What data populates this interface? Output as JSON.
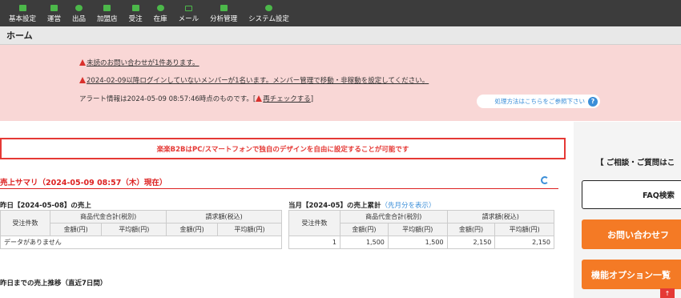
{
  "nav": {
    "items": [
      {
        "label": "基本設定",
        "icon": "sliders-icon"
      },
      {
        "label": "運営",
        "icon": "document-icon"
      },
      {
        "label": "出品",
        "icon": "tag-icon"
      },
      {
        "label": "加盟店",
        "icon": "store-icon"
      },
      {
        "label": "受注",
        "icon": "cart-icon"
      },
      {
        "label": "在庫",
        "icon": "box-icon"
      },
      {
        "label": "メール",
        "icon": "mail-icon"
      },
      {
        "label": "分析管理",
        "icon": "chart-icon"
      },
      {
        "label": "システム設定",
        "icon": "gear-icon"
      }
    ]
  },
  "breadcrumb": {
    "title": "ホーム"
  },
  "alerts": {
    "line1": "未読のお問い合わせが1件あります。",
    "line2": "2024-02-09以降ログインしていないメンバーが1名います。メンバー管理で移動・非稼動を設定してください。",
    "line3_prefix": "アラート情報は2024-05-09 08:57:46時点のものです。[",
    "line3_link": "再チェックする",
    "line3_suffix": "]",
    "help_text": "処理方法はこちらをご参照下さい",
    "help_icon": "?"
  },
  "banner": {
    "text": "楽楽B2BはPC/スマートフォンで独自のデザインを自由に設定することが可能です"
  },
  "summary": {
    "title": "売上サマリ（2024-05-09 08:57（木）現在）",
    "yesterday": {
      "title": "昨日【2024-05-08】の売上",
      "headers": {
        "orders": "受注件数",
        "product_total": "商品代金合計(税別)",
        "billing": "請求額(税込)",
        "amount": "金額(円)",
        "average": "平均額(円)"
      },
      "empty_text": "データがありません"
    },
    "month": {
      "title": "当月【2024-05】の売上累計",
      "prev_link": "（先月分を表示）",
      "headers": {
        "orders": "受注件数",
        "product_total": "商品代金合計(税別)",
        "billing": "請求額(税込)",
        "amount": "金額(円)",
        "average": "平均額(円)"
      },
      "row": {
        "orders": "1",
        "product_amount": "1,500",
        "product_average": "1,500",
        "billing_amount": "2,150",
        "billing_average": "2,150"
      }
    },
    "trend_title": "昨日までの売上推移（直近7日間）"
  },
  "sidebar": {
    "heading": "【 ご相談・ご質問はこ",
    "faq_label": "FAQ検索",
    "contact_label": "お問い合わせフ",
    "options_label": "機能オプション一覧"
  },
  "colors": {
    "nav_bg": "#3c3c3c",
    "nav_icon": "#4cb84a",
    "alert_bg": "#f9d7d6",
    "accent_red": "#e53935",
    "link_blue": "#3a8ed8",
    "orange": "#f47a25"
  }
}
